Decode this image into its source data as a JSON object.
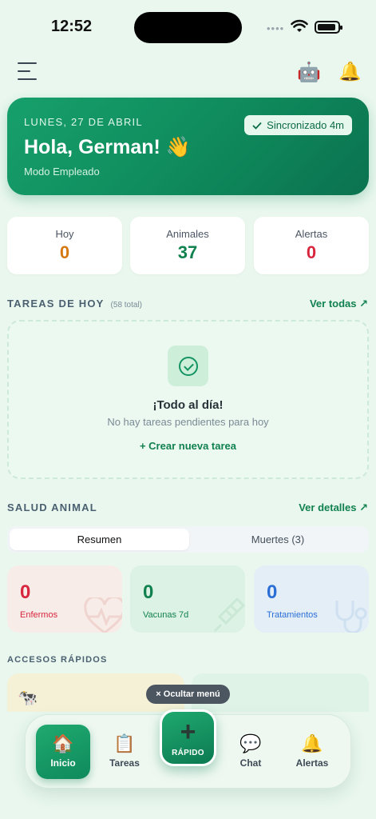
{
  "status_bar": {
    "time": "12:52"
  },
  "icons": {
    "menu": "hamburger-icon",
    "assistant": "robot-icon",
    "notifications": "bell-icon"
  },
  "hero": {
    "date": "LUNES, 27 DE ABRIL",
    "greeting": "Hola, German! 👋",
    "mode": "Modo Empleado",
    "sync": "Sincronizado 4m"
  },
  "stats": [
    {
      "label": "Hoy",
      "value": "0",
      "color": "#d4780f"
    },
    {
      "label": "Animales",
      "value": "37",
      "color": "#11814f"
    },
    {
      "label": "Alertas",
      "value": "0",
      "color": "#d7263d"
    }
  ],
  "tasks": {
    "title": "TAREAS DE HOY",
    "count": "(58 total)",
    "link": "Ver todas ↗",
    "empty_title": "¡Todo al día!",
    "empty_sub": "No hay tareas pendientes para hoy",
    "create": "+ Crear nueva tarea"
  },
  "health": {
    "title": "SALUD ANIMAL",
    "link": "Ver detalles ↗",
    "tabs": [
      "Resumen",
      "Muertes (3)"
    ],
    "active_tab": "Resumen",
    "cards": [
      {
        "value": "0",
        "label": "Enfermos",
        "color": "#d7263d",
        "bg": "#f7ece8",
        "icon": "heart-pulse-icon"
      },
      {
        "value": "0",
        "label": "Vacunas 7d",
        "color": "#11814f",
        "bg": "#dcf2e4",
        "icon": "syringe-icon"
      },
      {
        "value": "0",
        "label": "Tratamientos",
        "color": "#2b6fd6",
        "bg": "#e3eef7",
        "icon": "stethoscope-icon"
      }
    ]
  },
  "quick": {
    "title": "ACCESOS RÁPIDOS",
    "hide_menu": "× Ocultar menú"
  },
  "nav": {
    "items": [
      {
        "label": "Inicio",
        "icon": "🏠"
      },
      {
        "label": "Tareas",
        "icon": "📋"
      },
      {
        "label": "Chat",
        "icon": "💬"
      },
      {
        "label": "Alertas",
        "icon": "🔔"
      }
    ],
    "active": "Inicio",
    "fab_icon": "+",
    "fab_label": "RÁPIDO"
  }
}
